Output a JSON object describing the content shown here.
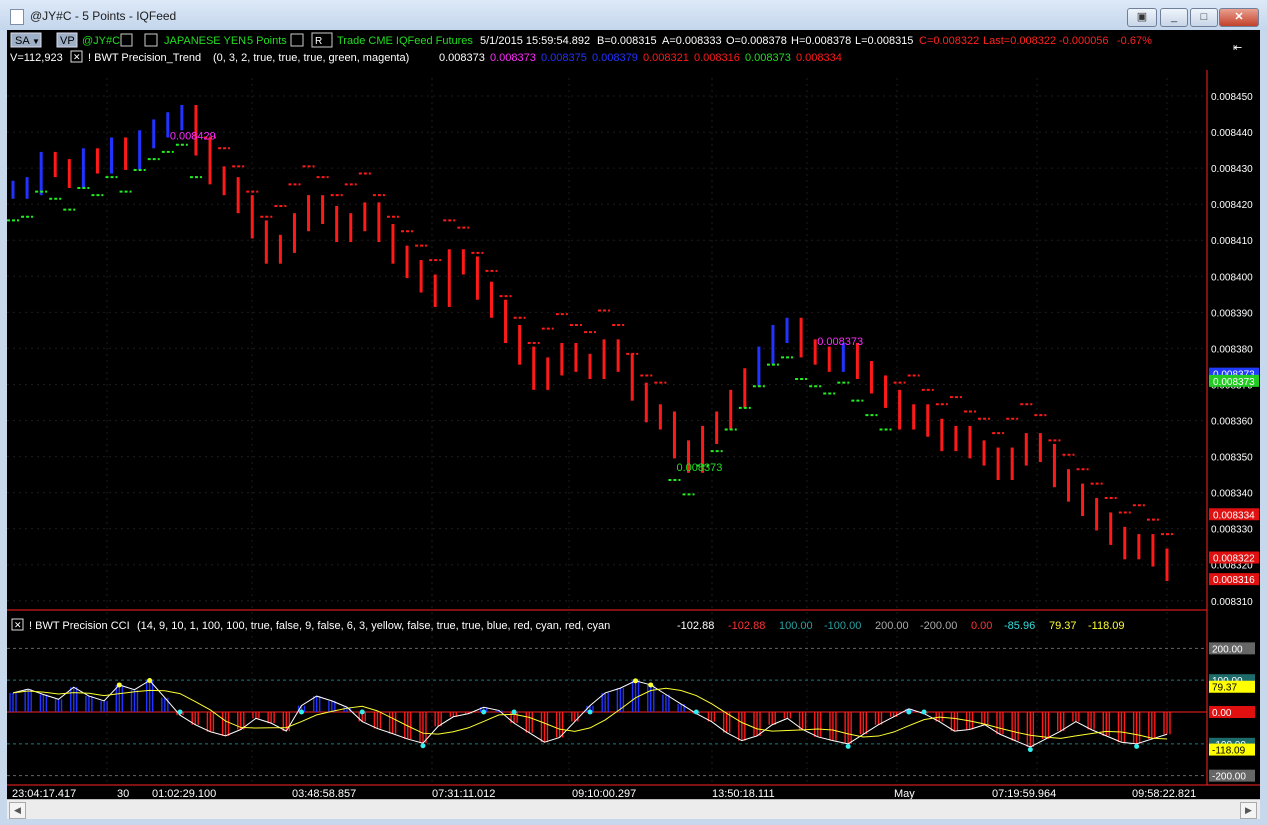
{
  "window": {
    "title": "@JY#C - 5 Points - IQFeed"
  },
  "toolbar": {
    "sa": "SA",
    "vp": "VP",
    "symbol": "@JY#C",
    "name": "JAPANESE YEN",
    "interval": "5 Points",
    "r": "R",
    "info": "Trade  CME  IQFeed  Futures",
    "datetime": "5/1/2015  15:59:54.892",
    "bid": "B=0.008315",
    "ask": "A=0.008333",
    "open": "O=0.008378",
    "high": "H=0.008378",
    "low": "L=0.008315",
    "close": "C=0.008322",
    "last": "Last=0.008322",
    "change": "-0.000056",
    "pct": "-0.67%"
  },
  "trend_line": {
    "volume": "V=112,923",
    "name": "! BWT Precision_Trend",
    "params": "(0, 3, 2, true, true, true, green, magenta)",
    "values": [
      {
        "text": "0.008373",
        "color": "#ffffff"
      },
      {
        "text": "0.008373",
        "color": "#ff2bff"
      },
      {
        "text": "0.008375",
        "color": "#2233ff"
      },
      {
        "text": "0.008379",
        "color": "#2233ff"
      },
      {
        "text": "0.008321",
        "color": "#ff1a1a"
      },
      {
        "text": "0.008316",
        "color": "#ff1a1a"
      },
      {
        "text": "0.008373",
        "color": "#22dd22"
      },
      {
        "text": "0.008334",
        "color": "#ff1a1a"
      }
    ]
  },
  "price_axis": [
    "0.008450",
    "0.008440",
    "0.008430",
    "0.008420",
    "0.008410",
    "0.008400",
    "0.008390",
    "0.008380",
    "0.008370",
    "0.008360",
    "0.008350",
    "0.008340",
    "0.008330",
    "0.008320",
    "0.008310"
  ],
  "price_tags": [
    {
      "text": "0.008373",
      "color": "#1f3cff"
    },
    {
      "text": "0.008373",
      "color": "#22cc22"
    },
    {
      "text": "0.008334",
      "color": "#e01010"
    },
    {
      "text": "0.008322",
      "color": "#e01010"
    },
    {
      "text": "0.008316",
      "color": "#e01010"
    }
  ],
  "chart_labels": [
    {
      "text": "0.008429",
      "color": "#ff2bff"
    },
    {
      "text": "0.008373",
      "color": "#22dd22"
    },
    {
      "text": "0.008373",
      "color": "#ff2bff"
    }
  ],
  "cci": {
    "name": "! BWT Precision CCI",
    "params": "(14, 9, 10, 1, 100, 100, true, false, 9, false, 6, 3, yellow, false, true, true, blue, red, cyan, red, cyan",
    "values": [
      {
        "text": "-102.88",
        "color": "#ffffff"
      },
      {
        "text": "-102.88",
        "color": "#ff3333"
      },
      {
        "text": "100.00",
        "color": "#2aa0a0"
      },
      {
        "text": "-100.00",
        "color": "#2aa0a0"
      },
      {
        "text": "200.00",
        "color": "#aaaaaa"
      },
      {
        "text": "-200.00",
        "color": "#aaaaaa"
      },
      {
        "text": "0.00",
        "color": "#ff3333"
      },
      {
        "text": "-85.96",
        "color": "#33dddd"
      },
      {
        "text": "79.37",
        "color": "#ffff33"
      },
      {
        "text": "-118.09",
        "color": "#ffff33"
      }
    ],
    "axis_tags": [
      {
        "text": "200.00",
        "bg": "#666666",
        "fg": "#ffffff"
      },
      {
        "text": "100.00",
        "bg": "#1e6b6b",
        "fg": "#ffffff"
      },
      {
        "text": "79.37",
        "bg": "#ffff00",
        "fg": "#000000"
      },
      {
        "text": "0.00",
        "bg": "#e01010",
        "fg": "#ffffff"
      },
      {
        "text": "-100.00",
        "bg": "#1e6b6b",
        "fg": "#ffffff"
      },
      {
        "text": "-118.09",
        "bg": "#ffff00",
        "fg": "#000000"
      },
      {
        "text": "-200.00",
        "bg": "#666666",
        "fg": "#ffffff"
      }
    ]
  },
  "time_axis": [
    "23:04:17.417",
    "30",
    "01:02:29.100",
    "03:48:58.857",
    "07:31:11.012",
    "09:10:00.297",
    "13:50:18.111",
    "May",
    "07:19:59.964",
    "09:58:22.821"
  ],
  "chart_data": {
    "type": "bar",
    "series": [
      {
        "name": "! BWT Precision_Trend",
        "close": [
          0.008424,
          0.008425,
          0.008432,
          0.00843,
          0.008427,
          0.008433,
          0.008431,
          0.008436,
          0.008432,
          0.008438,
          0.008441,
          0.008443,
          0.008445,
          0.008436,
          0.008428,
          0.008425,
          0.00842,
          0.008413,
          0.008406,
          0.008409,
          0.008415,
          0.00842,
          0.008417,
          0.008412,
          0.008415,
          0.008418,
          0.008412,
          0.008406,
          0.008402,
          0.008398,
          0.008394,
          0.008405,
          0.008403,
          0.008396,
          0.008391,
          0.008384,
          0.008378,
          0.008371,
          0.008375,
          0.008379,
          0.008376,
          0.008374,
          0.00838,
          0.008376,
          0.008368,
          0.008362,
          0.00836,
          0.008352,
          0.008348,
          0.008356,
          0.00836,
          0.008366,
          0.008372,
          0.008378,
          0.008384,
          0.008386,
          0.00838,
          0.008378,
          0.008376,
          0.008379,
          0.008374,
          0.00837,
          0.008366,
          0.00836,
          0.008362,
          0.008358,
          0.008354,
          0.008356,
          0.008352,
          0.00835,
          0.008346,
          0.00835,
          0.008354,
          0.008351,
          0.008344,
          0.00834,
          0.008336,
          0.008332,
          0.008328,
          0.008324,
          0.008326,
          0.008322,
          0.008318
        ]
      }
    ],
    "ylim": [
      0.008308,
      0.008455
    ],
    "cci": [
      60,
      72,
      55,
      40,
      78,
      50,
      35,
      85,
      70,
      99,
      45,
      -10,
      -40,
      -62,
      -75,
      -55,
      -20,
      -35,
      -60,
      20,
      50,
      35,
      15,
      -30,
      -52,
      -68,
      -85,
      -98,
      -45,
      -15,
      -5,
      15,
      5,
      -35,
      -65,
      -95,
      -80,
      -30,
      20,
      60,
      75,
      98,
      85,
      55,
      25,
      -5,
      -30,
      -65,
      -90,
      -75,
      -40,
      -20,
      -55,
      -78,
      -90,
      -100,
      -70,
      -40,
      -15,
      10,
      -5,
      -30,
      -60,
      -55,
      -40,
      -70,
      -90,
      -110,
      -85,
      -60,
      -30,
      -55,
      -75,
      -95,
      -100,
      -85,
      -70
    ],
    "cci_ylim": [
      -220,
      220
    ]
  }
}
